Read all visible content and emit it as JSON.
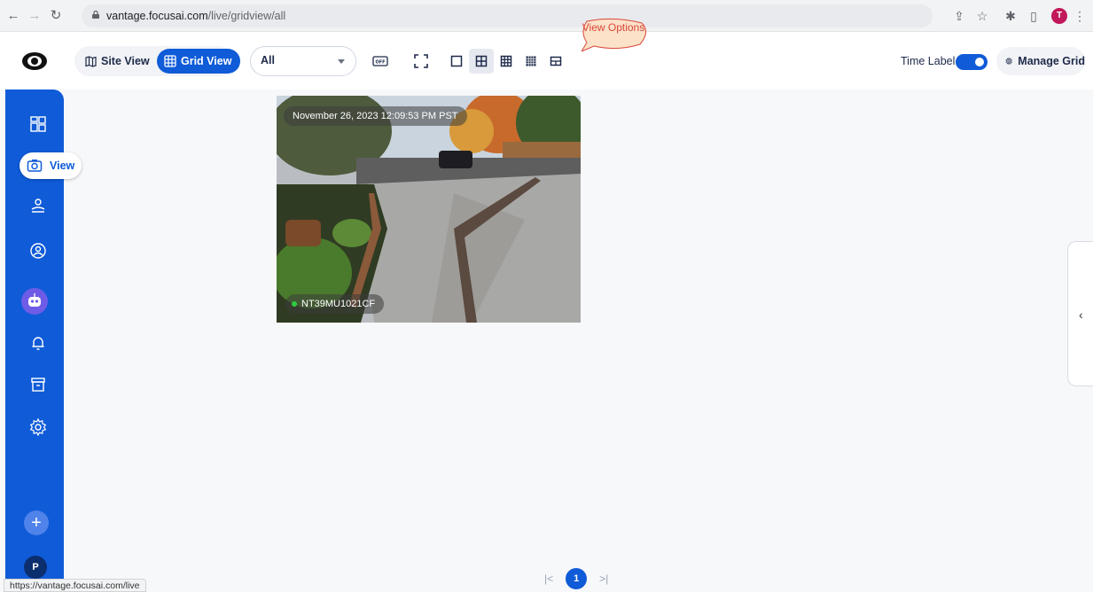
{
  "browser": {
    "url_host": "vantage.focusai.com",
    "url_path": "/live/gridview/all",
    "profile_initial": "T",
    "status_url": "https://vantage.focusai.com/live"
  },
  "toolbar": {
    "site_view_label": "Site View",
    "grid_view_label": "Grid View",
    "filter_value": "All",
    "time_label": "Time Label",
    "time_label_enabled": true,
    "manage_grid_label": "Manage Grid",
    "callout_text": "View Options",
    "overlay_badge": "OFF",
    "active_layout": "2x2"
  },
  "sidebar": {
    "active_item_label": "View",
    "avatar_initial": "P",
    "add_label": "+"
  },
  "tiles": [
    {
      "timestamp": "November 26, 2023 12:09:53 PM PST",
      "camera_name": "NT39MU1021CF",
      "status": "online"
    }
  ],
  "pagination": {
    "current_page": "1",
    "first_label": "|<",
    "last_label": ">|"
  },
  "colors": {
    "primary": "#0f5bd8",
    "callout": "#d9483b",
    "online": "#2ecc40"
  }
}
